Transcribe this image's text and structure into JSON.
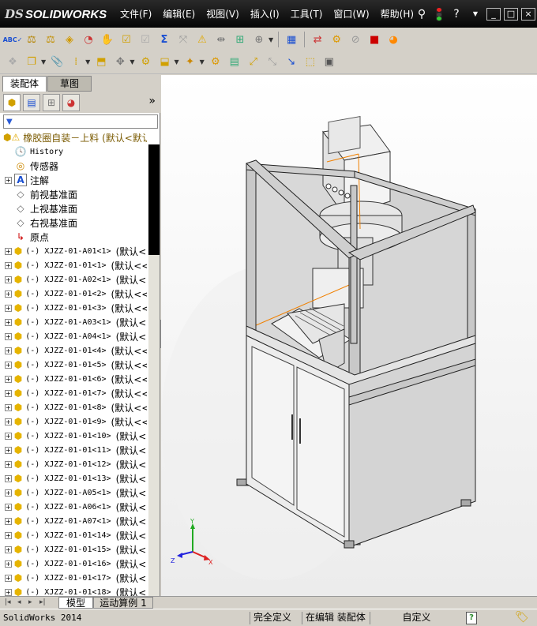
{
  "app": {
    "logo_ds": "DS",
    "logo_name": "SOLIDWORKS",
    "menu": [
      "文件(F)",
      "编辑(E)",
      "视图(V)",
      "插入(I)",
      "工具(T)",
      "窗口(W)",
      "帮助(H)"
    ],
    "window_controls": [
      "_",
      "□",
      "×"
    ]
  },
  "left_panel": {
    "tabs": [
      "装配体",
      "草图"
    ],
    "root": "橡胶圈自装－上料 (默认<默认_",
    "fixed_items": [
      {
        "label": "History",
        "icon": "history-icon"
      },
      {
        "label": "传感器",
        "icon": "sensor-icon"
      },
      {
        "label": "注解",
        "icon": "annotation-icon"
      },
      {
        "label": "前视基准面",
        "icon": "plane-icon"
      },
      {
        "label": "上视基准面",
        "icon": "plane-icon"
      },
      {
        "label": "右视基准面",
        "icon": "plane-icon"
      },
      {
        "label": "原点",
        "icon": "origin-icon"
      }
    ],
    "components": [
      "(-) XJZZ-01-A01<1>",
      "(-) XJZZ-01-01<1>",
      "(-) XJZZ-01-A02<1>",
      "(-) XJZZ-01-01<2>",
      "(-) XJZZ-01-01<3>",
      "(-) XJZZ-01-A03<1>",
      "(-) XJZZ-01-A04<1>",
      "(-) XJZZ-01-01<4>",
      "(-) XJZZ-01-01<5>",
      "(-) XJZZ-01-01<6>",
      "(-) XJZZ-01-01<7>",
      "(-) XJZZ-01-01<8>",
      "(-) XJZZ-01-01<9>",
      "(-) XJZZ-01-01<10>",
      "(-) XJZZ-01-01<11>",
      "(-) XJZZ-01-01<12>",
      "(-) XJZZ-01-01<13>",
      "(-) XJZZ-01-A05<1>",
      "(-) XJZZ-01-A06<1>",
      "(-) XJZZ-01-A07<1>",
      "(-) XJZZ-01-01<14>",
      "(-) XJZZ-01-01<15>",
      "(-) XJZZ-01-01<16>",
      "(-) XJZZ-01-01<17>",
      "(-) XJZZ-01-01<18>"
    ],
    "component_config": "(默认<<默"
  },
  "bottom_tabs": [
    "模型",
    "运动算例 1"
  ],
  "status": {
    "app": "SolidWorks 2014",
    "definition": "完全定义",
    "editing": "在编辑 装配体",
    "custom": "自定义",
    "help": "?"
  },
  "colors": {
    "titlebar": "#0a0a0a",
    "chrome": "#d4d0c8",
    "part_icon": "#e6b400",
    "accent": "#2a5bd7"
  }
}
